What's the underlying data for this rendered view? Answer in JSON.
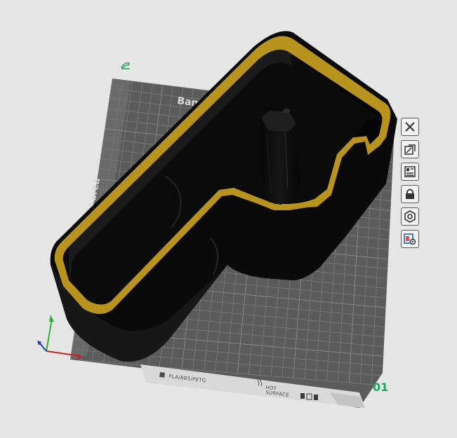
{
  "plate": {
    "brand_label": "Bam",
    "exclusion_label": "only area",
    "material_label": "PLA/ABS/PETG",
    "surface_label_line1": "HOT",
    "surface_label_line2": "SURFACE",
    "index": "01"
  },
  "toolbar": {
    "items": [
      {
        "name": "close-icon"
      },
      {
        "name": "auto-orient-icon"
      },
      {
        "name": "arrange-icon"
      },
      {
        "name": "lock-icon"
      },
      {
        "name": "plate-settings-icon"
      },
      {
        "name": "slice-plate-icon"
      }
    ]
  },
  "colors": {
    "background": "#e6e6e6",
    "plate": "#5b5b5b",
    "grid_line": "#747474",
    "model_body": "#0d0d0d",
    "model_top_edge": "#b8941e",
    "plate_index": "#22a75a",
    "edit_icon": "#22a75a"
  }
}
